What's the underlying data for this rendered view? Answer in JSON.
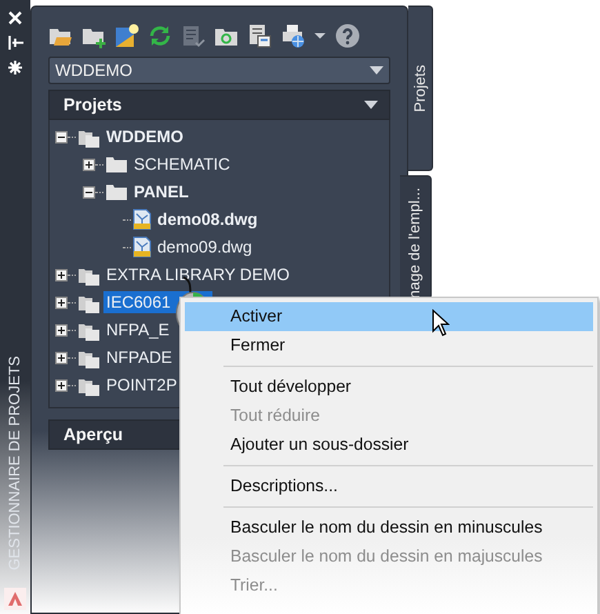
{
  "side_strip": {
    "title": "GESTIONNAIRE DE PROJETS"
  },
  "project_dropdown": {
    "value": "WDDEMO"
  },
  "projects_panel": {
    "title": "Projets",
    "tree": [
      {
        "label": "WDDEMO",
        "kind": "project",
        "active": true,
        "expanded": true,
        "selected": false,
        "children": [
          {
            "label": "SCHEMATIC",
            "kind": "folder",
            "active": false,
            "expanded": false,
            "selected": false
          },
          {
            "label": "PANEL",
            "kind": "folder",
            "active": true,
            "expanded": true,
            "selected": false,
            "children": [
              {
                "label": "demo08.dwg",
                "kind": "drawing",
                "active": true,
                "selected": false
              },
              {
                "label": "demo09.dwg",
                "kind": "drawing",
                "active": false,
                "selected": false
              }
            ]
          }
        ]
      },
      {
        "label": "EXTRA LIBRARY DEMO",
        "kind": "project",
        "active": false,
        "expanded": false,
        "selected": false
      },
      {
        "label": "IEC6061",
        "kind": "project",
        "active": false,
        "expanded": false,
        "selected": true
      },
      {
        "label": "NFPA_E",
        "kind": "project",
        "active": false,
        "expanded": false,
        "selected": false
      },
      {
        "label": "NFPADE",
        "kind": "project",
        "active": false,
        "expanded": false,
        "selected": false
      },
      {
        "label": "POINT2P",
        "kind": "project",
        "active": false,
        "expanded": false,
        "selected": false
      }
    ]
  },
  "preview_panel": {
    "title": "Aperçu"
  },
  "side_tabs": [
    {
      "label": "Projets",
      "selected": true
    },
    {
      "label": "nage de l'empl...",
      "selected": false
    }
  ],
  "context_menu": {
    "groups": [
      [
        {
          "label": "Activer",
          "selected": true,
          "disabled": false
        },
        {
          "label": "Fermer",
          "selected": false,
          "disabled": false
        }
      ],
      [
        {
          "label": "Tout développer",
          "selected": false,
          "disabled": false
        },
        {
          "label": "Tout réduire",
          "selected": false,
          "disabled": true
        },
        {
          "label": "Ajouter un sous-dossier",
          "selected": false,
          "disabled": false
        }
      ],
      [
        {
          "label": "Descriptions...",
          "selected": false,
          "disabled": false
        }
      ],
      [
        {
          "label": "Basculer le nom du dessin en minuscules",
          "selected": false,
          "disabled": false
        },
        {
          "label": "Basculer le nom du dessin en majuscules",
          "selected": false,
          "disabled": true
        },
        {
          "label": "Trier...",
          "selected": false,
          "disabled": true
        }
      ]
    ]
  }
}
